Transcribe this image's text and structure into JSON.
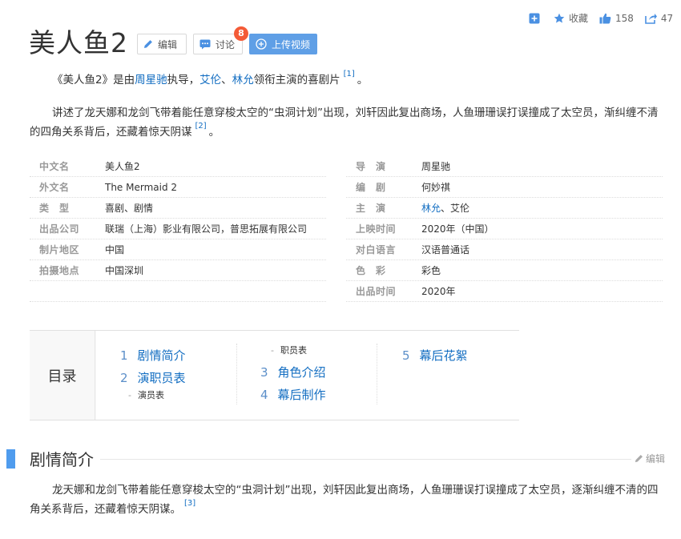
{
  "actions": {
    "favorite_label": "收藏",
    "like_count": "158",
    "share_count": "47"
  },
  "title": "美人鱼2",
  "buttons": {
    "edit": "编辑",
    "discuss": "讨论",
    "discuss_badge": "8",
    "upload": "上传视频"
  },
  "summary": {
    "p1_a": "《美人鱼2》是由",
    "p1_director": "周星驰",
    "p1_b": "执导，",
    "p1_actor1": "艾伦",
    "p1_sep": "、",
    "p1_actor2": "林允",
    "p1_c": "领衔主演的喜剧片",
    "p1_ref": "[1]",
    "p1_end": "。",
    "p2": "讲述了龙天娜和龙剑飞带着能任意穿梭太空的“虫洞计划”出现，刘轩因此复出商场，人鱼珊珊误打误撞成了太空员，渐纠缠不清的四角关系背后，还藏着惊天阴谋",
    "p2_ref": "[2]",
    "p2_end": "。"
  },
  "infobox": {
    "left": [
      {
        "key": "中文名",
        "value": "美人鱼2"
      },
      {
        "key": "外文名",
        "value": "The Mermaid 2"
      },
      {
        "key": "类　型",
        "value": "喜剧、剧情"
      },
      {
        "key": "出品公司",
        "value": "联瑞（上海）影业有限公司，普思拓展有限公司"
      },
      {
        "key": "制片地区",
        "value": "中国"
      },
      {
        "key": "拍摄地点",
        "value": "中国深圳"
      }
    ],
    "right": [
      {
        "key": "导　演",
        "value": "周星驰"
      },
      {
        "key": "编　剧",
        "value": "何妙祺"
      },
      {
        "key": "主　演",
        "value_link": "林允",
        "value_rest": "、艾伦"
      },
      {
        "key": "上映时间",
        "value": "2020年（中国）"
      },
      {
        "key": "对白语言",
        "value": "汉语普通话"
      },
      {
        "key": "色　彩",
        "value": "彩色"
      },
      {
        "key": "出品时间",
        "value": "2020年"
      }
    ]
  },
  "catalog": {
    "title": "目录",
    "items": [
      {
        "num": "1",
        "label": "剧情简介"
      },
      {
        "num": "2",
        "label": "演职员表"
      },
      {
        "num": "3",
        "label": "角色介绍"
      },
      {
        "num": "4",
        "label": "幕后制作"
      },
      {
        "num": "5",
        "label": "幕后花絮"
      }
    ],
    "subs": [
      "演员表",
      "职员表"
    ]
  },
  "section": {
    "title": "剧情简介",
    "edit_label": "编辑",
    "text": "龙天娜和龙剑飞带着能任意穿梭太空的“虫洞计划”出现，刘轩因此复出商场，人鱼珊珊误打误撞成了太空员，逐渐纠缠不清的四角关系背后，还藏着惊天阴谋。",
    "ref": "[3]"
  }
}
